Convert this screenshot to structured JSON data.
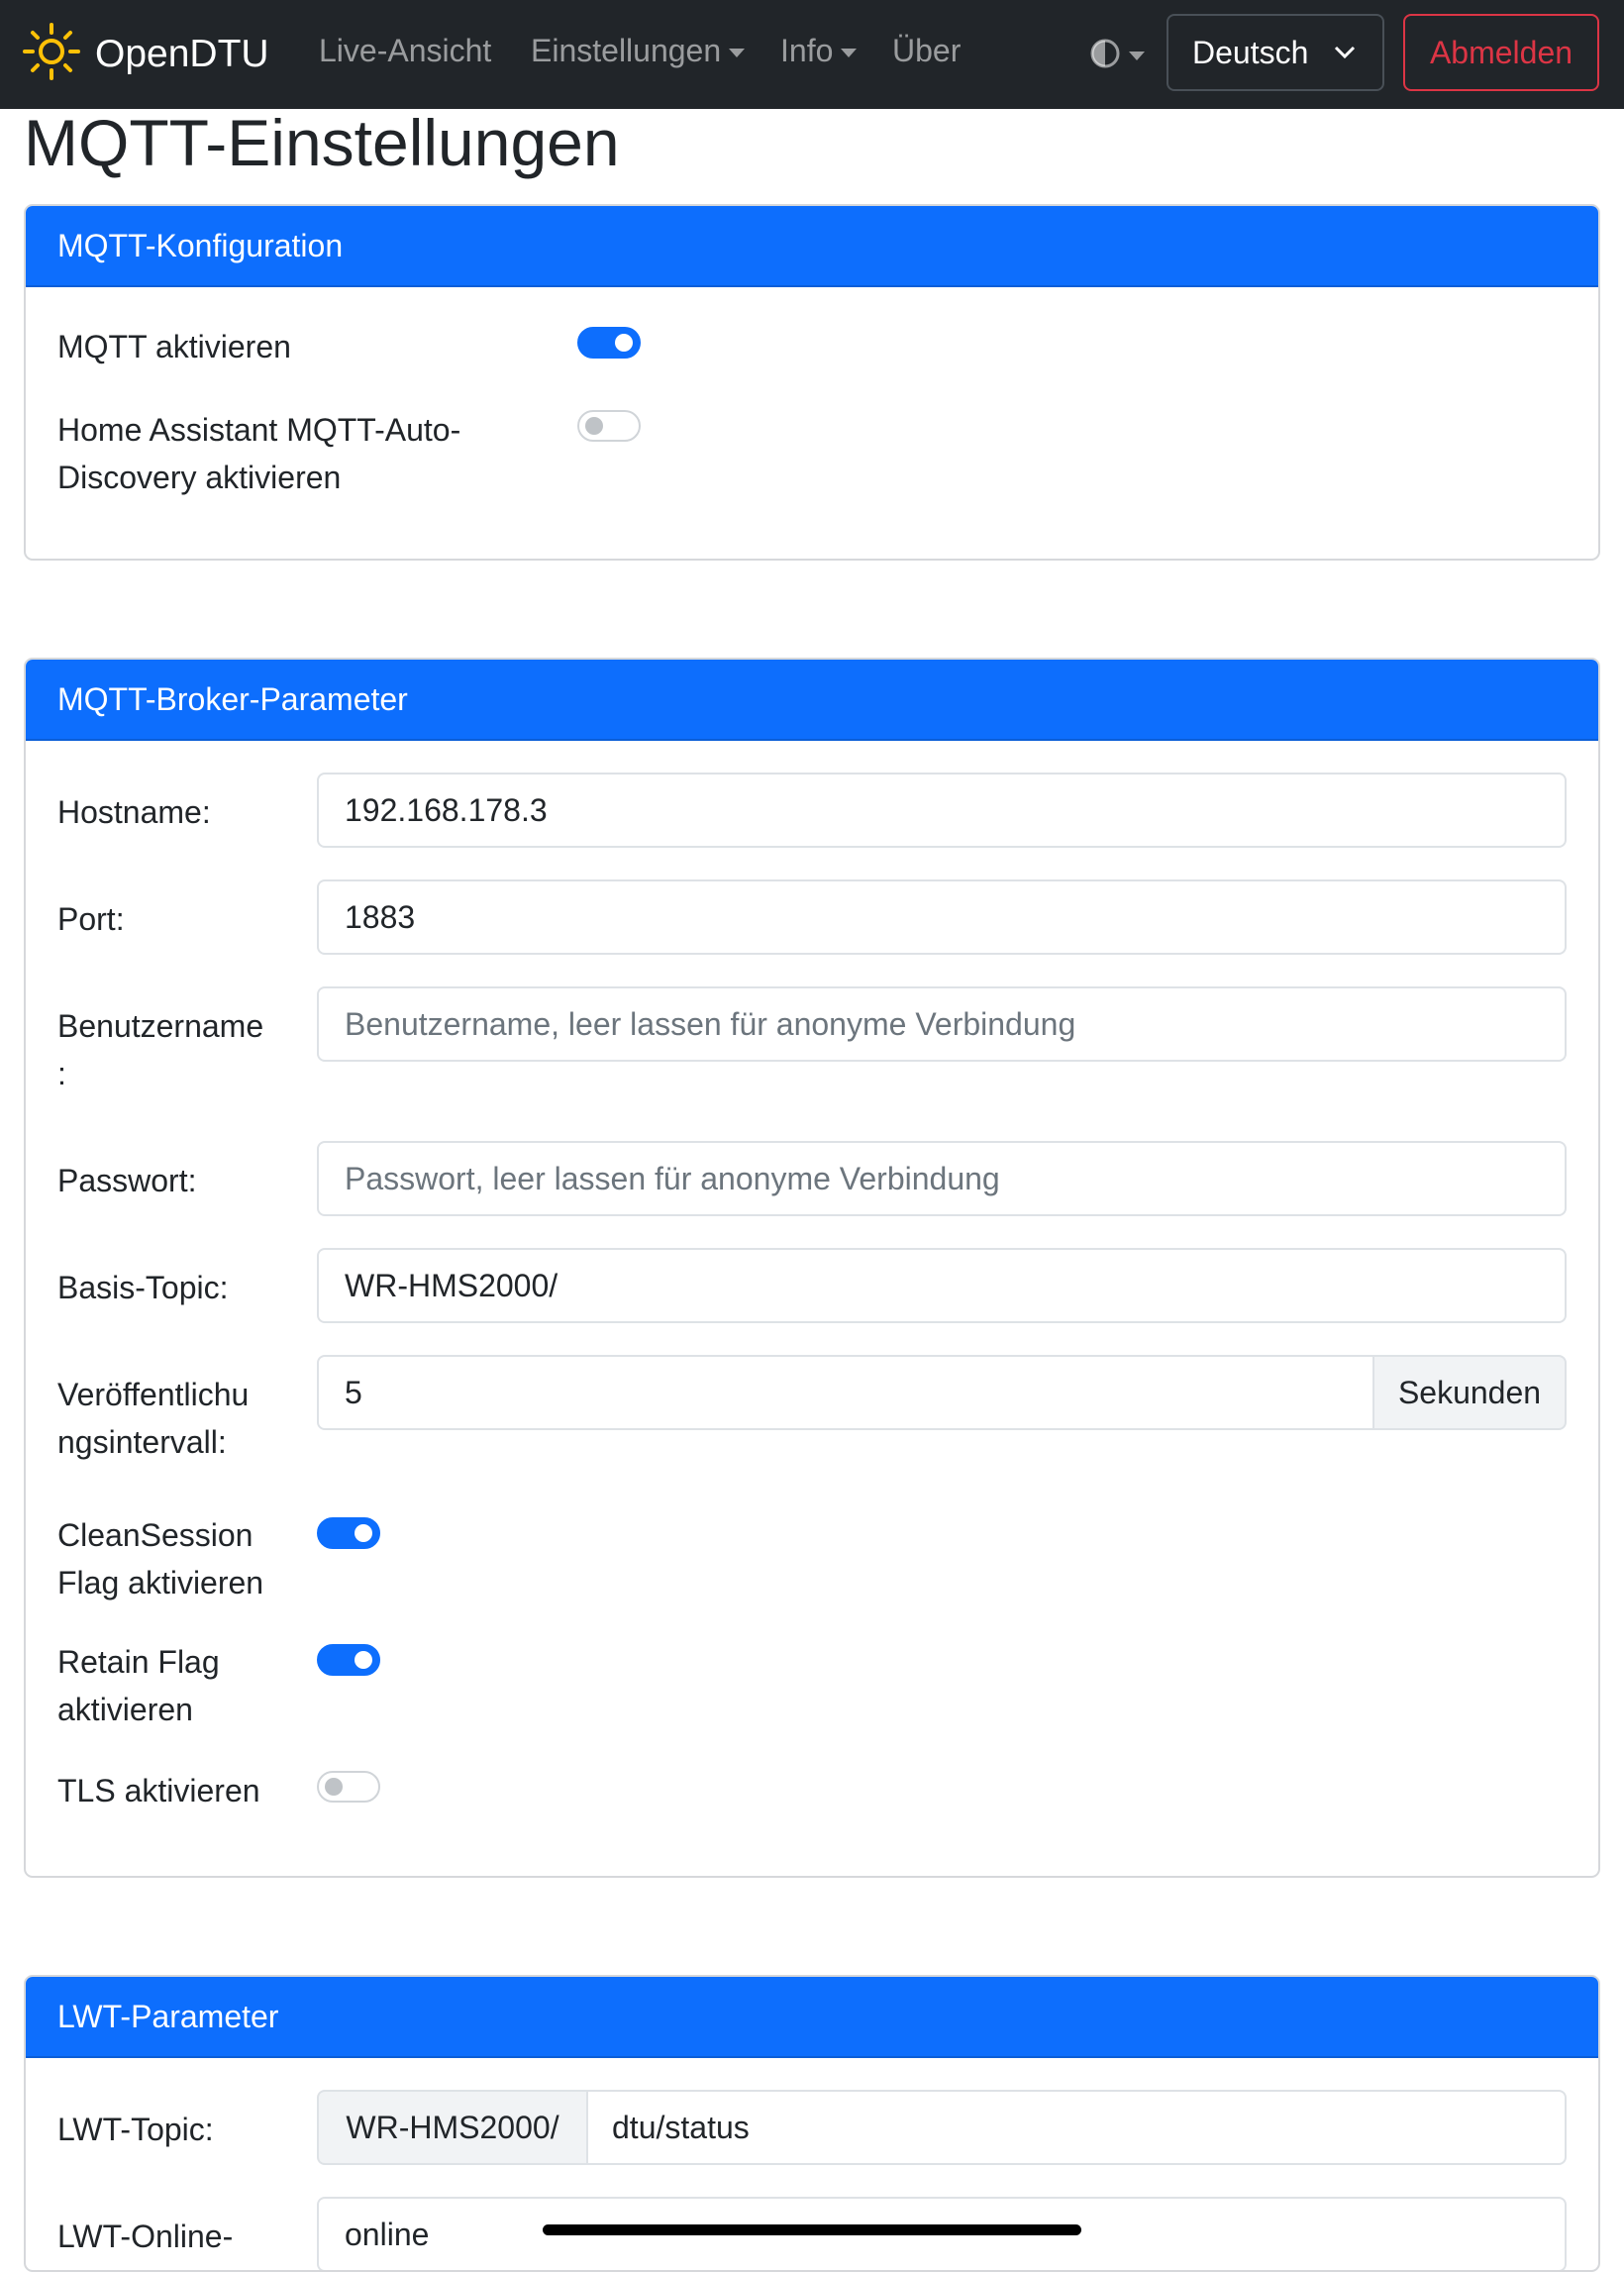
{
  "navbar": {
    "brand": "OpenDTU",
    "links": {
      "live": "Live-Ansicht",
      "settings": "Einstellungen",
      "info": "Info",
      "about": "Über"
    },
    "language": "Deutsch",
    "logout": "Abmelden",
    "brand_icon": "sun-icon",
    "theme_icon": "contrast-icon"
  },
  "page": {
    "title": "MQTT-Einstellungen"
  },
  "mqtt_config": {
    "header": "MQTT-Konfiguration",
    "enable_label": "MQTT aktivieren",
    "enable_value": true,
    "hass_label_line1": "Home Assistant MQTT-Auto-",
    "hass_label_line2": "Discovery aktivieren",
    "hass_value": false
  },
  "broker": {
    "header": "MQTT-Broker-Parameter",
    "hostname_label": "Hostname:",
    "hostname_value": "192.168.178.3",
    "port_label": "Port:",
    "port_value": "1883",
    "username_label_line1": "Benutzername",
    "username_label_line2": ":",
    "username_placeholder": "Benutzername, leer lassen für anonyme Verbindung",
    "password_label": "Passwort:",
    "password_placeholder": "Passwort, leer lassen für anonyme Verbindung",
    "topic_label": "Basis-Topic:",
    "topic_value": "WR-HMS2000/",
    "interval_label_line1": "Veröffentlichu",
    "interval_label_line2": "ngsintervall:",
    "interval_value": "5",
    "interval_unit": "Sekunden",
    "clean_label_line1": "CleanSession",
    "clean_label_line2": "Flag aktivieren",
    "clean_value": true,
    "retain_label_line1": "Retain Flag",
    "retain_label_line2": "aktivieren",
    "retain_value": true,
    "tls_label": "TLS aktivieren",
    "tls_value": false
  },
  "lwt": {
    "header": "LWT-Parameter",
    "topic_label": "LWT-Topic:",
    "topic_prefix": "WR-HMS2000/",
    "topic_value": "dtu/status",
    "online_label": "LWT-Online-",
    "online_value": "online"
  }
}
